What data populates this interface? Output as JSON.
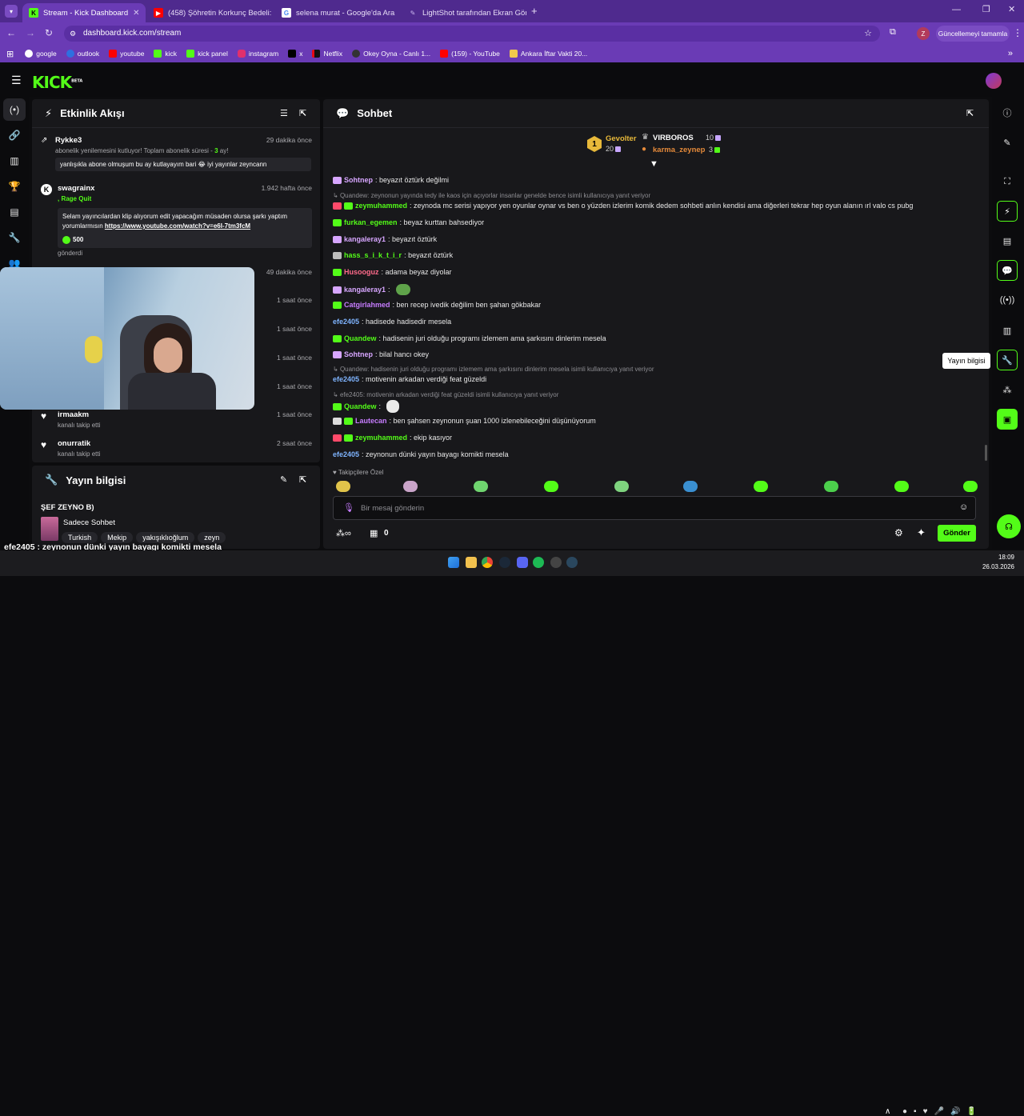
{
  "browser": {
    "tabs": [
      {
        "label": "Stream - Kick Dashboard",
        "active": true
      },
      {
        "label": "(458) Şöhretin Korkunç Bedeli:"
      },
      {
        "label": "selena murat - Google'da Ara"
      },
      {
        "label": "LightShot tarafından Ekran Gör"
      }
    ],
    "url": "dashboard.kick.com/stream",
    "update_button": "Güncellemeyi tamamla",
    "profile_initial": "Z",
    "bookmarks": [
      "google",
      "outlook",
      "youtube",
      "kick",
      "kick panel",
      "instagram",
      "x",
      "Netflix",
      "Okey Oyna - Canlı 1...",
      "(159) - YouTube",
      "Ankara İftar Vakti 20..."
    ]
  },
  "kick": {
    "logo": "KICK",
    "logo_sup": "BETA"
  },
  "activity": {
    "title": "Etkinlik Akışı",
    "events": [
      {
        "name": "Rykke3",
        "time": "29 dakika önce",
        "text_pre": "abonelik yenilemesini kutluyor! Toplam abonelik süresi - ",
        "text_num": "3",
        "text_post": " ay!",
        "message": "yanlışıkla abone olmuşum bu ay kutlayayım bari 😂 iyi yayınlar zeyncann"
      },
      {
        "name": "swagrainx",
        "time": "1.942 hafta önce",
        "sub": ", Rage Quit",
        "message": "Selam yayıncılardan klip alıyorum edit yapacağım müsaden olursa şarkı yaptım yorumlarmısın ",
        "link": "https://www.youtube.com/watch?v=e6I-7tm3fcM",
        "amount": "500",
        "footer": "gönderdi"
      },
      {
        "time": "49 dakika önce"
      },
      {
        "time": "1 saat önce"
      },
      {
        "time": "1 saat önce"
      },
      {
        "time": "1 saat önce"
      },
      {
        "time": "1 saat önce"
      },
      {
        "name": "irmaakm",
        "time": "1 saat önce",
        "sub": "kanalı takip etti"
      },
      {
        "name": "onurratik",
        "time": "2 saat önce",
        "sub": "kanalı takip etti"
      }
    ]
  },
  "stream_info": {
    "title": "Yayın bilgisi",
    "stream_title": "ŞEF ZEYNO B)",
    "category": "Sadece Sohbet",
    "tags": [
      "Turkish",
      "Mekip",
      "yakışıklıoğlum",
      "zeyn"
    ],
    "overlay": "efe2405 : zeynonun dünki yayın bayagı komikti mesela"
  },
  "chat": {
    "title": "Sohbet",
    "leaderboard": {
      "rank": "1",
      "first_name": "Gevolter",
      "first_count": "20",
      "second_name": "VIRBOROS",
      "second_count": "10",
      "third_name": "karma_zeynep",
      "third_count": "3"
    },
    "messages": [
      {
        "user": "Sohtnep",
        "color": "#d7a6ff",
        "text": ": beyazıt öztürk değilmi"
      },
      {
        "reply": "Quandew: zeynonun yayında tedy ile kaos için açıyorlar insanlar genelde bence isimli kullanıcıya yanıt veriyor"
      },
      {
        "user": "zeymuhammed",
        "color": "#53fc18",
        "text": ": zeynoda mc serisi yapıyor yen oyunlar oynar vs ben o yüzden izlerim komik dedem sohbeti anlın kendisi ama diğerleri tekrar hep oyun alanın ırl valo cs pubg"
      },
      {
        "user": "furkan_egemen",
        "color": "#53fc18",
        "text": ": beyaz kurttan bahsediyor"
      },
      {
        "user": "kangaleray1",
        "color": "#d7a6ff",
        "text": ": beyazıt öztürk"
      },
      {
        "user": "hass_s_i_k_t_i_r",
        "color": "#53fc18",
        "text": ": beyazıt öztürk"
      },
      {
        "user": "Husooguz",
        "color": "#ff6b8b",
        "text": ": adama beyaz diyolar"
      },
      {
        "user": "kangaleray1",
        "color": "#d7a6ff",
        "text": ":"
      },
      {
        "user": "Catgirlahmed",
        "color": "#c77dff",
        "text": ": ben recep ivedik değilim ben şahan gökbakar"
      },
      {
        "user": "efe2405",
        "color": "#7fb4ff",
        "text": ": hadisede hadisedir mesela"
      },
      {
        "user": "Quandew",
        "color": "#53fc18",
        "text": ": hadisenin juri olduğu programı izlemem ama şarkısını dinlerim mesela"
      },
      {
        "user": "Sohtnep",
        "color": "#d7a6ff",
        "text": ": bilal hancı okey"
      },
      {
        "reply": "Quandew: hadisenin juri olduğu programı izlemem ama şarkısını dinlerim mesela isimli kullanıcıya yanıt veriyor"
      },
      {
        "user": "efe2405",
        "color": "#7fb4ff",
        "text": ": motivenin arkadan verdiği feat güzeldi"
      },
      {
        "reply": "efe2405: motivenin arkadan verdiği feat güzeldi isimli kullanıcıya yanıt veriyor"
      },
      {
        "user": "Quandew",
        "color": "#53fc18",
        "text": ":"
      },
      {
        "user": "Lautecan",
        "color": "#c77dff",
        "text": ": ben şahsen zeynonun şuan 1000 izlenebileceğini düşünüyorum"
      },
      {
        "user": "zeymuhammed",
        "color": "#53fc18",
        "text": ": ekip kasıyor"
      },
      {
        "user": "efe2405",
        "color": "#7fb4ff",
        "text": ": zeynonun dünki yayın bayagı komikti mesela"
      }
    ],
    "followers_only": "Takipçilere Özel",
    "input_placeholder": "Bir mesaj gönderin",
    "points": "0",
    "send_label": "Gönder",
    "tooltip": "Yayın bilgisi"
  },
  "taskbar": {
    "time": "18:09",
    "date": "26.03.2026"
  }
}
